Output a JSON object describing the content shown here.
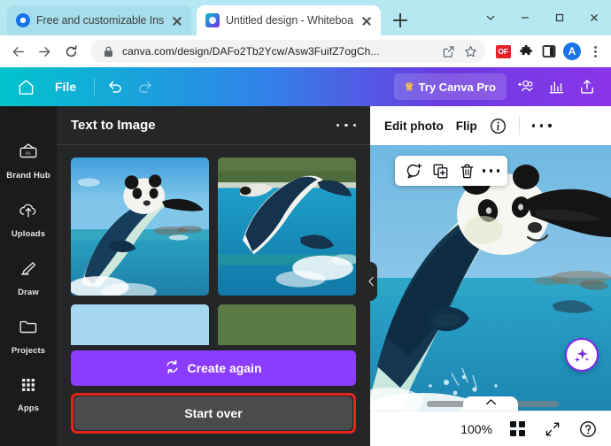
{
  "browser": {
    "tabs": [
      {
        "title": "Free and customizable Instag",
        "favicon": "chrome-icon",
        "active": false
      },
      {
        "title": "Untitled design - Whiteboard",
        "favicon": "canva-icon",
        "active": true
      }
    ],
    "new_tab_label": "+",
    "window_controls": [
      "chevron-down-icon",
      "minimize-icon",
      "maximize-icon",
      "close-icon"
    ],
    "nav": {
      "back": "back-arrow-icon",
      "forward": "forward-arrow-icon",
      "reload": "reload-icon"
    },
    "omnibox": {
      "lock": "lock-icon",
      "url": "canva.com/design/DAFo2Tb2Ycw/Asw3FuifZ7ogCh...",
      "share": "share-icon",
      "bookmark": "star-icon"
    },
    "extensions": [
      {
        "name": "of-extension-icon",
        "label": "OF",
        "color": "#e8202a"
      },
      {
        "name": "puzzle-icon",
        "label": ""
      },
      {
        "name": "side-panel-icon",
        "label": ""
      }
    ],
    "profile": {
      "initial": "A",
      "color": "#1a73e8"
    },
    "menu": "kebab-menu-icon"
  },
  "canva_toolbar": {
    "home": "home-icon",
    "file_label": "File",
    "undo": "undo-icon",
    "redo": "redo-icon",
    "pro_label": "Try Canva Pro",
    "pro_crown": "crown-icon",
    "share_people": "add-people-icon",
    "analytics": "bar-chart-icon",
    "upload": "upload-icon",
    "gradient_start": "#00c4cc",
    "gradient_end": "#8b35e8"
  },
  "sidebar": {
    "items": [
      {
        "label": "Brand Hub",
        "icon": "brand-hub-icon"
      },
      {
        "label": "Uploads",
        "icon": "cloud-upload-icon"
      },
      {
        "label": "Draw",
        "icon": "pen-icon"
      },
      {
        "label": "Projects",
        "icon": "folder-icon"
      },
      {
        "label": "Apps",
        "icon": "apps-grid-icon"
      }
    ]
  },
  "panel": {
    "title": "Text to Image",
    "more_menu": "more-options-icon",
    "results": [
      {
        "alt": "panda-dolphin-jumping-1"
      },
      {
        "alt": "dolphin-jumping-2"
      },
      {
        "alt": "panda-dolphin-jumping-3"
      },
      {
        "alt": "panda-dolphin-jumping-4"
      }
    ],
    "create_again_label": "Create again",
    "create_again_icon": "refresh-icon",
    "create_again_color": "#8b3dff",
    "start_over_label": "Start over",
    "start_over_highlight_color": "#e8231c",
    "collapse_icon": "chevron-left-icon"
  },
  "editor": {
    "toolbar": {
      "edit_photo_label": "Edit photo",
      "flip_label": "Flip",
      "info_icon": "info-icon",
      "more_icon": "more-options-icon"
    },
    "float_toolbar": {
      "comment_icon": "add-comment-icon",
      "duplicate_icon": "duplicate-icon",
      "delete_icon": "trash-icon",
      "more_icon": "more-options-icon"
    },
    "magic_button_icon": "magic-sparkle-icon",
    "collapse_icon": "chevron-up-icon",
    "scrollbar": "horizontal-scrollbar"
  },
  "statusbar": {
    "zoom_level": "100%",
    "grid_icon": "grid-view-icon",
    "fullscreen_icon": "expand-icon",
    "help_icon": "help-icon"
  }
}
